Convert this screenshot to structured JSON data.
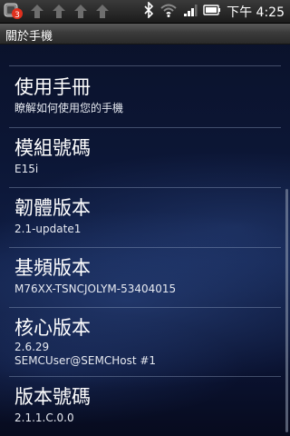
{
  "status_bar": {
    "notification_count": "3",
    "time": "下午 4:25",
    "icons": [
      "app-notification-icon",
      "upload-arrow-icon",
      "upload-arrow-icon",
      "upload-arrow-icon",
      "upload-arrow-icon",
      "bluetooth-icon",
      "wifi-icon",
      "signal-icon",
      "battery-icon"
    ]
  },
  "title_bar": {
    "title": "關於手機"
  },
  "settings": [
    {
      "title": "使用手冊",
      "summary": [
        "瞭解如何使用您的手機"
      ]
    },
    {
      "title": "模組號碼",
      "summary": [
        "E15i"
      ]
    },
    {
      "title": "韌體版本",
      "summary": [
        "2.1-update1"
      ]
    },
    {
      "title": "基頻版本",
      "summary": [
        "M76XX-TSNCJOLYM-53404015"
      ]
    },
    {
      "title": "核心版本",
      "summary": [
        "2.6.29",
        "SEMCUser@SEMCHost #1"
      ]
    },
    {
      "title": "版本號碼",
      "summary": [
        "2.1.1.C.0.0"
      ]
    }
  ]
}
